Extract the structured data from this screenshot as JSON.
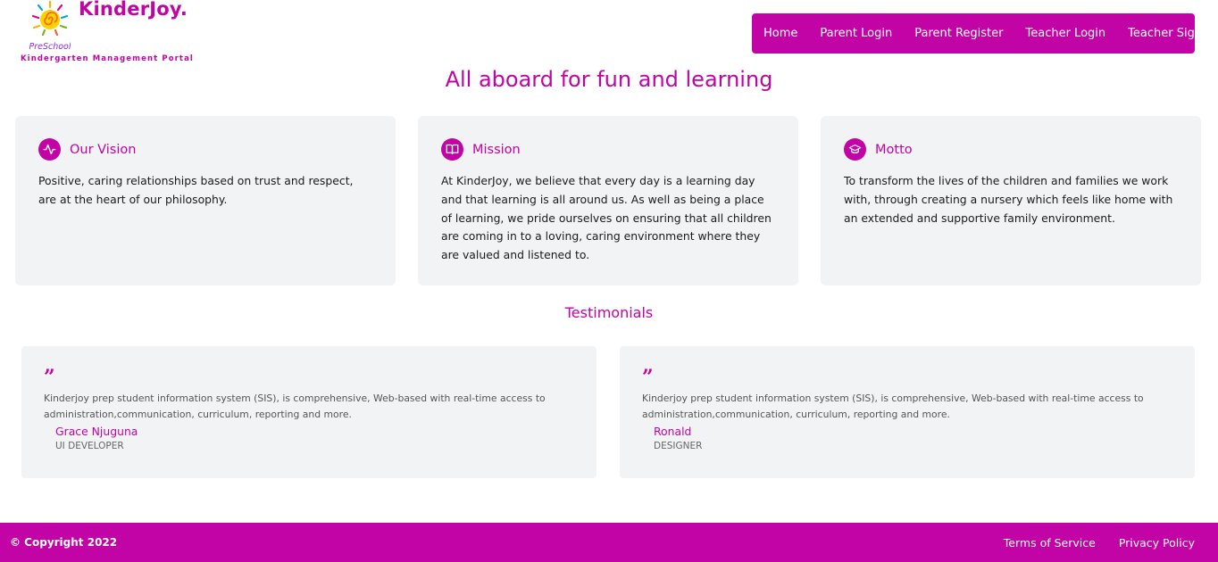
{
  "header": {
    "brand": "KinderJoy.",
    "logo_text": "PreSchool",
    "tagline": "Kindergarten Management Portal"
  },
  "nav": {
    "items": [
      "Home",
      "Parent Login",
      "Parent Register",
      "Teacher Login",
      "Teacher Signup"
    ]
  },
  "hero": {
    "title": "All aboard for fun and learning"
  },
  "cards": [
    {
      "icon": "activity-icon",
      "title": "Our Vision",
      "text": "Positive, caring relationships based on trust and respect, are at the heart of our philosophy."
    },
    {
      "icon": "book-open-icon",
      "title": "Mission",
      "text": "At KinderJoy, we believe that every day is a learning day and that learning is all around us. As well as being a place of learning, we pride ourselves on ensuring that all children are coming in to a loving, caring environment where they are valued and listened to."
    },
    {
      "icon": "graduation-cap-icon",
      "title": "Motto",
      "text": "To transform the lives of the children and families we work with, through creating a nursery which feels like home with an extended and supportive family environment."
    }
  ],
  "testimonials": {
    "title": "Testimonials",
    "quote_mark": "”",
    "items": [
      {
        "text": "Kinderjoy prep student information system (SIS), is comprehensive, Web-based with real-time access to administration,communication, curriculum, reporting and more.",
        "name": "Grace Njuguna",
        "role": "UI DEVELOPER"
      },
      {
        "text": "Kinderjoy prep student information system (SIS), is comprehensive, Web-based with real-time access to administration,communication, curriculum, reporting and more.",
        "name": "Ronald",
        "role": "DESIGNER"
      }
    ]
  },
  "footer": {
    "copyright": "© Copyright 2022",
    "links": [
      "Terms of Service",
      "Privacy Policy"
    ]
  },
  "colors": {
    "accent": "#c203a5",
    "card_bg": "#f2f3f5"
  }
}
